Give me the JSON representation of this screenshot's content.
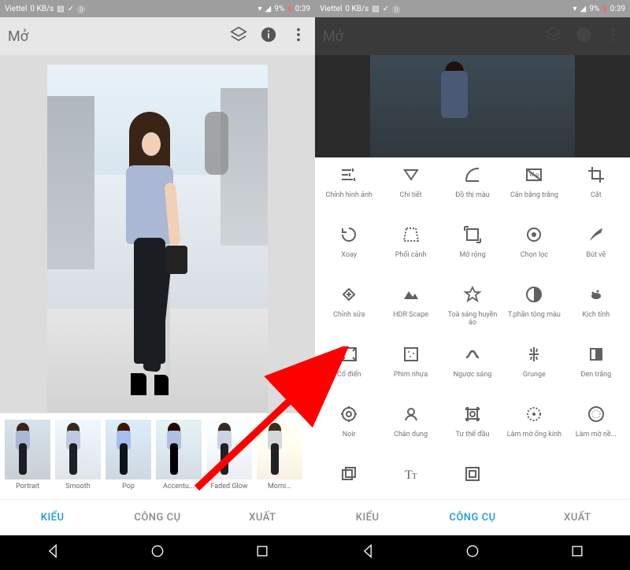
{
  "status": {
    "carrier": "Viettel",
    "data_rate": "0 KB/s",
    "battery": "9%",
    "time": "0:39",
    "signal_icon": "signal-icon",
    "wifi_icon": "wifi-icon"
  },
  "app": {
    "title": "Mở"
  },
  "filters": [
    {
      "label": "Portrait"
    },
    {
      "label": "Smooth"
    },
    {
      "label": "Pop"
    },
    {
      "label": "Accentu..."
    },
    {
      "label": "Faded Glow"
    },
    {
      "label": "Morni..."
    }
  ],
  "tabs": {
    "styles": "KIỂU",
    "tools": "CÔNG CỤ",
    "export": "XUẤT"
  },
  "tools": [
    {
      "label": "Chỉnh hình ảnh",
      "icon": "tune"
    },
    {
      "label": "Chi tiết",
      "icon": "triangle-down"
    },
    {
      "label": "Đồ thị màu",
      "icon": "curves"
    },
    {
      "label": "Cân bằng trắng",
      "icon": "wb"
    },
    {
      "label": "Cắt",
      "icon": "crop"
    },
    {
      "label": "Xoay",
      "icon": "rotate"
    },
    {
      "label": "Phối cảnh",
      "icon": "perspective"
    },
    {
      "label": "Mở rộng",
      "icon": "expand"
    },
    {
      "label": "Chọn lọc",
      "icon": "target"
    },
    {
      "label": "Bút vẽ",
      "icon": "brush"
    },
    {
      "label": "Chỉnh sửa",
      "icon": "healing"
    },
    {
      "label": "HDR Scape",
      "icon": "hdr"
    },
    {
      "label": "Toà sáng huyền ảo",
      "icon": "glamour"
    },
    {
      "label": "T.phần tông màu",
      "icon": "tonal"
    },
    {
      "label": "Kịch tính",
      "icon": "drama"
    },
    {
      "label": "Cổ điển",
      "icon": "vintage"
    },
    {
      "label": "Phim nhựa",
      "icon": "grainy"
    },
    {
      "label": "Ngược sáng",
      "icon": "retrolux"
    },
    {
      "label": "Grunge",
      "icon": "grunge"
    },
    {
      "label": "Đen trắng",
      "icon": "bw"
    },
    {
      "label": "Noir",
      "icon": "noir"
    },
    {
      "label": "Chân dung",
      "icon": "portrait"
    },
    {
      "label": "Tư thế đầu",
      "icon": "headpose"
    },
    {
      "label": "Làm mờ ống kính",
      "icon": "lensblur"
    },
    {
      "label": "Làm mờ nề...",
      "icon": "vignette"
    },
    {
      "label": "",
      "icon": "doubleexp"
    },
    {
      "label": "",
      "icon": "text"
    },
    {
      "label": "",
      "icon": "frames"
    }
  ]
}
